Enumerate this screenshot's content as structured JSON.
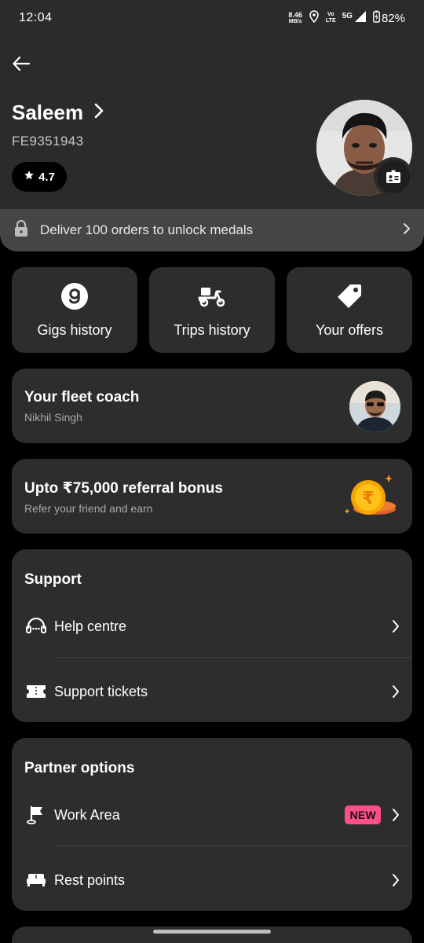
{
  "status_bar": {
    "time": "12:04",
    "speed_value": "8.46",
    "speed_unit": "MB/s",
    "volte_top": "Vo",
    "volte_bottom": "LTE",
    "network": "5G",
    "battery": "82%"
  },
  "profile": {
    "name": "Saleem",
    "id": "FE9351943",
    "rating": "4.7"
  },
  "medals": {
    "text": "Deliver 100 orders to unlock medals"
  },
  "tiles": [
    {
      "label": "Gigs history",
      "icon": "gigs-icon"
    },
    {
      "label": "Trips history",
      "icon": "scooter-icon"
    },
    {
      "label": "Your offers",
      "icon": "tag-icon"
    }
  ],
  "coach": {
    "title": "Your fleet coach",
    "name": "Nikhil Singh"
  },
  "referral": {
    "title": "Upto ₹75,000 referral bonus",
    "subtitle": "Refer your friend and earn"
  },
  "support": {
    "title": "Support",
    "items": [
      {
        "label": "Help centre",
        "icon": "headset-icon"
      },
      {
        "label": "Support tickets",
        "icon": "ticket-icon"
      }
    ]
  },
  "partner": {
    "title": "Partner options",
    "items": [
      {
        "label": "Work Area",
        "icon": "flag-icon",
        "badge": "NEW"
      },
      {
        "label": "Rest points",
        "icon": "bed-icon"
      }
    ]
  },
  "colors": {
    "background": "#000000",
    "card": "#2d2d2d",
    "header": "#2b2b2b",
    "new_badge": "#ff4f8b",
    "coin_gold": "#f7b500"
  }
}
